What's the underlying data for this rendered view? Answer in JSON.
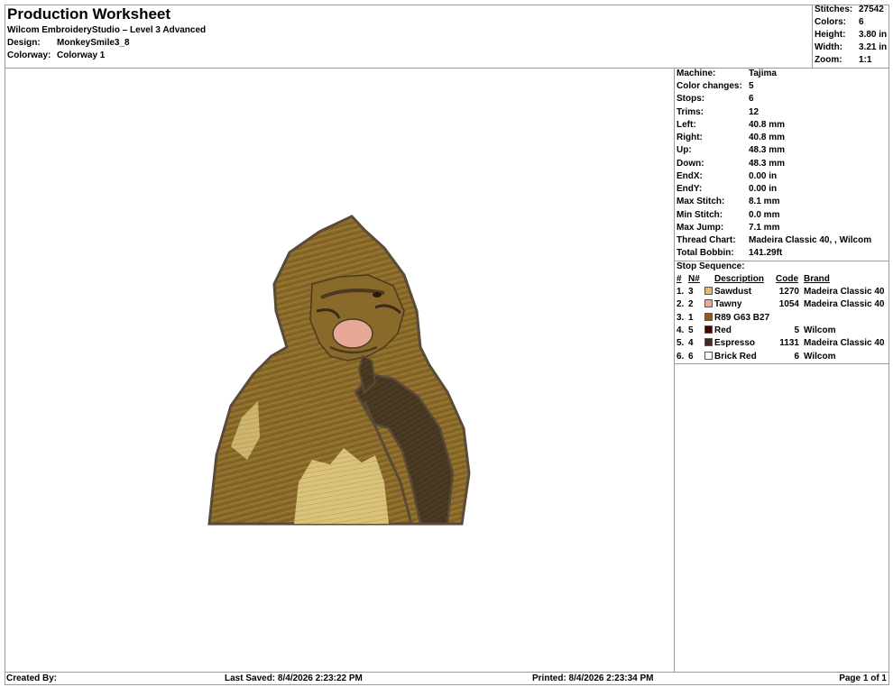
{
  "header": {
    "title": "Production Worksheet",
    "software": "Wilcom EmbroideryStudio – Level 3 Advanced",
    "design_label": "Design:",
    "design_value": "MonkeySmile3_8",
    "colorway_label": "Colorway:",
    "colorway_value": "Colorway 1"
  },
  "stats": [
    {
      "label": "Stitches:",
      "value": "27542"
    },
    {
      "label": "Colors:",
      "value": "6"
    },
    {
      "label": "Height:",
      "value": "3.80 in"
    },
    {
      "label": "Width:",
      "value": "3.21 in"
    },
    {
      "label": "Zoom:",
      "value": "1:1"
    }
  ],
  "info": [
    {
      "label": "Machine:",
      "value": "Tajima"
    },
    {
      "label": "Color changes:",
      "value": "5"
    },
    {
      "label": "Stops:",
      "value": "6"
    },
    {
      "label": "Trims:",
      "value": "12"
    },
    {
      "label": "Left:",
      "value": "40.8 mm"
    },
    {
      "label": "Right:",
      "value": "40.8 mm"
    },
    {
      "label": "Up:",
      "value": "48.3 mm"
    },
    {
      "label": "Down:",
      "value": "48.3 mm"
    },
    {
      "label": "EndX:",
      "value": "0.00 in"
    },
    {
      "label": "EndY:",
      "value": "0.00 in"
    },
    {
      "label": "Max Stitch:",
      "value": "8.1 mm"
    },
    {
      "label": "Min Stitch:",
      "value": "0.0 mm"
    },
    {
      "label": "Max Jump:",
      "value": "7.1 mm"
    },
    {
      "label": "Thread Chart:",
      "value": "Madeira Classic 40, , Wilcom"
    },
    {
      "label": "Total Bobbin:",
      "value": "141.29ft"
    }
  ],
  "stop_sequence": {
    "title": "Stop Sequence:",
    "headers": {
      "num": "#",
      "n": "N#",
      "desc": "Description",
      "code": "Code",
      "brand": "Brand"
    },
    "rows": [
      {
        "num": "1.",
        "n": "3",
        "color": "#e3b878",
        "desc": "Sawdust",
        "code": "1270",
        "brand": "Madeira Classic 40"
      },
      {
        "num": "2.",
        "n": "2",
        "color": "#f0a89a",
        "desc": "Tawny",
        "code": "1054",
        "brand": "Madeira Classic 40"
      },
      {
        "num": "3.",
        "n": "1",
        "color": "#8a5f1e",
        "desc": "R89 G63 B27",
        "code": "",
        "brand": ""
      },
      {
        "num": "4.",
        "n": "5",
        "color": "#4a0000",
        "desc": "Red",
        "code": "5",
        "brand": "Wilcom"
      },
      {
        "num": "5.",
        "n": "4",
        "color": "#3e2a22",
        "desc": "Espresso",
        "code": "1131",
        "brand": "Madeira Classic 40"
      },
      {
        "num": "6.",
        "n": "6",
        "color": "#ffffff",
        "desc": "Brick Red",
        "code": "6",
        "brand": "Wilcom"
      }
    ]
  },
  "footer": {
    "created_by": "Created By:",
    "last_saved": "Last Saved: 8/4/2026 2:23:22 PM",
    "printed": "Printed: 8/4/2026 2:23:34 PM",
    "page": "Page 1 of 1"
  },
  "colors": {
    "border": "#9a9a9a",
    "outline": "#5a4a38",
    "fur_main": "#8a6a2a",
    "fur_light": "#d9c27a",
    "fur_dark": "#4a3a22",
    "face_pink": "#e8a898"
  }
}
